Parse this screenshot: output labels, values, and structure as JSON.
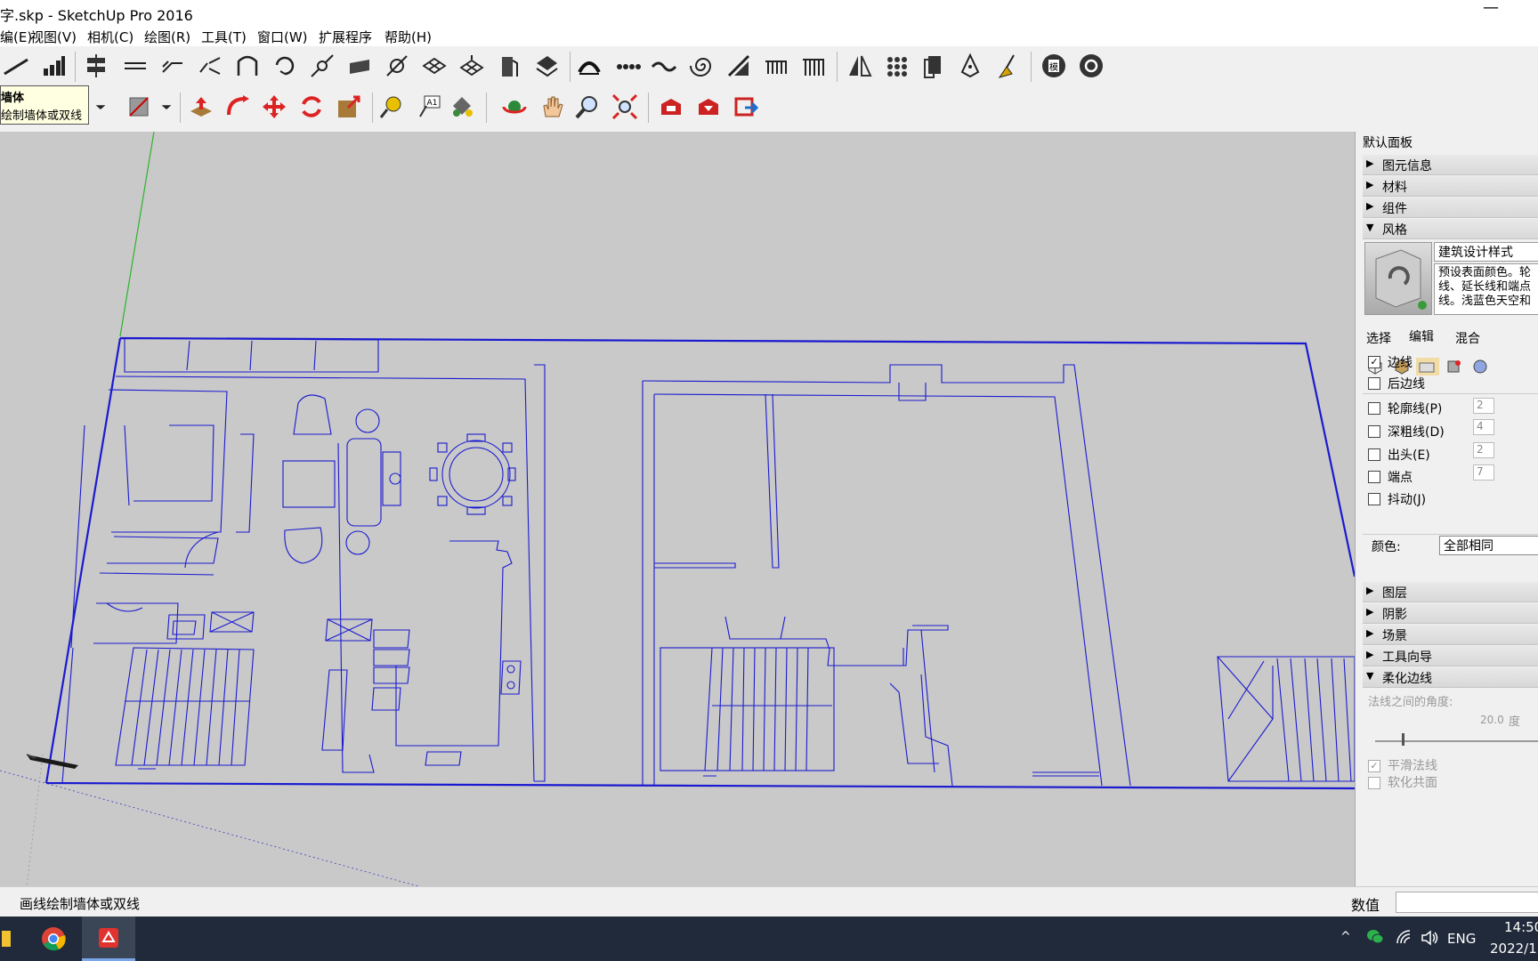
{
  "window": {
    "title": "字.skp - SketchUp Pro 2016",
    "minimize_glyph": "—"
  },
  "menu": [
    "编(E)",
    "视图(V)",
    "相机(C)",
    "绘图(R)",
    "工具(T)",
    "窗口(W)",
    "扩展程序",
    "帮助(H)"
  ],
  "tooltip": {
    "title": "墙体",
    "desc": "绘制墙体或双线"
  },
  "tray": {
    "title": "默认面板",
    "sections_top": [
      {
        "arrow": "▶",
        "label": "图元信息"
      },
      {
        "arrow": "▶",
        "label": "材料"
      },
      {
        "arrow": "▶",
        "label": "组件"
      },
      {
        "arrow": "▼",
        "label": "风格"
      }
    ],
    "style": {
      "name": "建筑设计样式",
      "desc_line1": "预设表面颜色。轮",
      "desc_line2": "线、延长线和端点",
      "desc_line3": "线。浅蓝色天空和"
    },
    "subtabs": [
      "选择",
      "编辑",
      "混合"
    ],
    "edge_options": [
      {
        "label": "边线",
        "checked": true,
        "value": ""
      },
      {
        "label": "后边线",
        "checked": false,
        "value": ""
      },
      {
        "label": "轮廓线(P)",
        "checked": false,
        "value": "2"
      },
      {
        "label": "深粗线(D)",
        "checked": false,
        "value": "4"
      },
      {
        "label": "出头(E)",
        "checked": false,
        "value": "2"
      },
      {
        "label": "端点",
        "checked": false,
        "value": "7"
      },
      {
        "label": "抖动(J)",
        "checked": false,
        "value": ""
      }
    ],
    "color_label": "颜色:",
    "color_value": "全部相同",
    "sections_bottom": [
      {
        "arrow": "▶",
        "label": "图层"
      },
      {
        "arrow": "▶",
        "label": "阴影"
      },
      {
        "arrow": "▶",
        "label": "场景"
      },
      {
        "arrow": "▶",
        "label": "工具向导"
      },
      {
        "arrow": "▼",
        "label": "柔化边线"
      }
    ],
    "soften": {
      "angle_label": "法线之间的角度:",
      "angle_value": "20.0",
      "angle_unit": "度",
      "smooth_normals": "平滑法线",
      "soften_coplanar": "软化共面"
    }
  },
  "status": {
    "text": "画线绘制墙体或双线",
    "value_label": "数值"
  },
  "taskbar": {
    "lang": "ENG",
    "time": "14:50",
    "date": "2022/1"
  },
  "colors": {
    "model_lines": "#1a1ad0",
    "viewport_bg": "#c9c9c9",
    "taskbar_bg": "#202a3a"
  }
}
